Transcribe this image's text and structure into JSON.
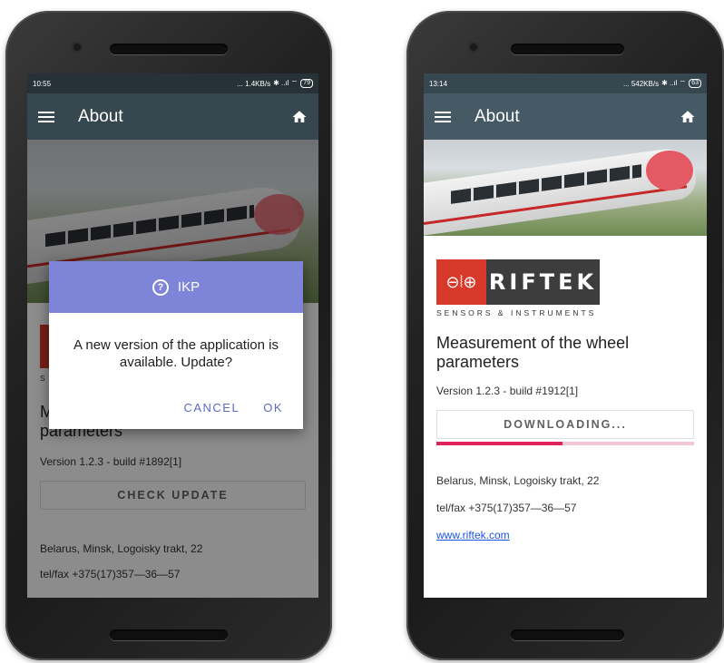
{
  "left_phone": {
    "status": {
      "time": "10:55",
      "indicators": "... 1.4KB/s",
      "battery": "79"
    },
    "app_bar": {
      "title": "About",
      "color": "#37474f"
    },
    "content": {
      "headline": "Measurement of the wheel parameters",
      "headline_visible_prefix": "M",
      "headline_visible_rest": "parameters",
      "tagline_prefix": "S",
      "version": "Version 1.2.3 - build #1892[1]",
      "check_update_label": "CHECK UPDATE",
      "address": "Belarus, Minsk, Logoisky trakt, 22",
      "phone": "tel/fax +375(17)357—36—57"
    },
    "dialog": {
      "title": "IKP",
      "message": "A new version of the application is available. Update?",
      "cancel_label": "CANCEL",
      "ok_label": "OK",
      "header_color": "#7e84d7"
    }
  },
  "right_phone": {
    "status": {
      "time": "13:14",
      "indicators": "... 542KB/s",
      "battery": "63"
    },
    "app_bar": {
      "title": "About",
      "color": "#455a64"
    },
    "content": {
      "logo_text": "RIFTEK",
      "tagline": "SENSORS & INSTRUMENTS",
      "headline": "Measurement of the wheel parameters",
      "version": "Version 1.2.3 - build #1912[1]",
      "downloading_label": "DOWNLOADING...",
      "progress": 0.49,
      "address": "Belarus, Minsk, Logoisky trakt, 22",
      "phone": "tel/fax +375(17)357—36—57",
      "website": "www.riftek.com"
    }
  }
}
